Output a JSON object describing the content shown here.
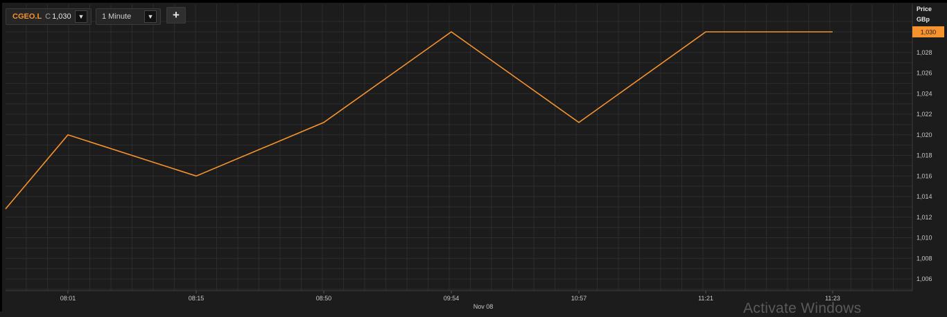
{
  "toolbar": {
    "symbol": "CGEO.L",
    "close_label": "C",
    "close_value": "1,030",
    "interval": "1 Minute",
    "add_label": "+"
  },
  "axis": {
    "price_label": "Price",
    "unit_label": "GBp",
    "date_label": "Nov 08"
  },
  "colors": {
    "background": "#1c1c1c",
    "grid": "#2d2d2d",
    "line": "#f7932e",
    "price_tag": "#f7932e"
  },
  "watermark": "Activate Windows",
  "chart_data": {
    "type": "line",
    "title": "",
    "xlabel": "",
    "ylabel": "Price GBp",
    "grid": true,
    "ylim": [
      1004.3,
      1031.3
    ],
    "y_ticks": [
      1006,
      1008,
      1010,
      1012,
      1014,
      1016,
      1018,
      1020,
      1022,
      1024,
      1026,
      1028
    ],
    "y_tick_labels": [
      "1,006",
      "1,008",
      "1,010",
      "1,012",
      "1,014",
      "1,016",
      "1,018",
      "1,020",
      "1,022",
      "1,024",
      "1,026",
      "1,028"
    ],
    "x_ticks": [
      "08:01",
      "08:15",
      "08:50",
      "09:54",
      "10:57",
      "11:21",
      "11:23"
    ],
    "last_price": 1030,
    "last_price_label": "1,030",
    "series": [
      {
        "x": [
          "",
          "08:01",
          "08:15",
          "08:50",
          "09:54",
          "10:57",
          "11:21",
          "11:23"
        ],
        "values": [
          1012.8,
          1020,
          1016,
          1021.2,
          1030,
          1021.2,
          1030,
          1030
        ]
      }
    ]
  }
}
